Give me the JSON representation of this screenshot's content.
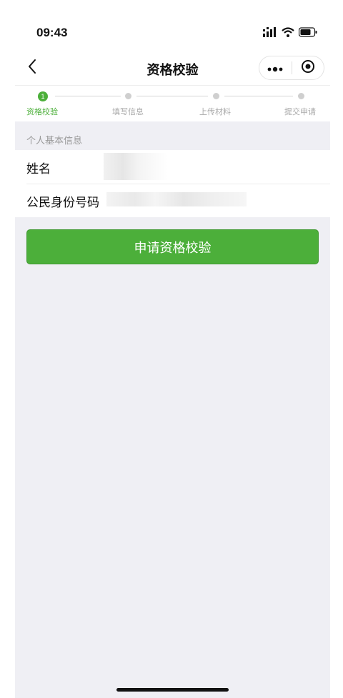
{
  "status_bar": {
    "time": "09:43",
    "icons": [
      "signal-icon",
      "wifi-icon",
      "battery-icon"
    ]
  },
  "nav": {
    "title": "资格校验",
    "back_icon": "chevron-left-icon",
    "capsule_icons": [
      "more-dots-icon",
      "close-circle-icon"
    ]
  },
  "steps": [
    {
      "label": "资格校验",
      "number": "1",
      "active": true
    },
    {
      "label": "填写信息",
      "active": false
    },
    {
      "label": "上传材料",
      "active": false
    },
    {
      "label": "提交申请",
      "active": false
    }
  ],
  "section": {
    "title": "个人基本信息"
  },
  "form": {
    "name_label": "姓名",
    "id_label": "公民身份号码"
  },
  "apply_button": {
    "label": "申请资格校验"
  },
  "colors": {
    "accent": "#4caf3a",
    "background": "#efeff4"
  }
}
